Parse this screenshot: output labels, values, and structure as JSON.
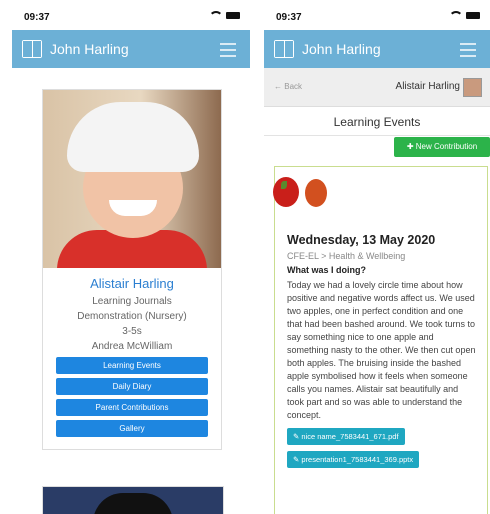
{
  "left": {
    "status_time": "09:37",
    "navbar_title": "John Harling",
    "child_name": "Alistair Harling",
    "journal": "Learning Journals",
    "setting": "Demonstration (Nursery)",
    "age": "3-5s",
    "keyworker": "Andrea McWilliam",
    "buttons": [
      "Learning Events",
      "Daily Diary",
      "Parent Contributions",
      "Gallery"
    ]
  },
  "right": {
    "status_time": "09:37",
    "navbar_title": "John Harling",
    "back_label": "Back",
    "user_name": "Alistair Harling",
    "section_title": "Learning Events",
    "new_button": "New Contribution",
    "entry": {
      "date": "Wednesday, 13 May 2020",
      "category": "CFE-EL > Health & Wellbeing",
      "question": "What was I doing?",
      "body": "Today we had a lovely circle time about how positive and negative words affect us. We used two apples, one in perfect condition and one that had been bashed around. We took turns to say something nice to one apple and something nasty to the other. We then cut open both apples. The bruising inside the bashed apple symbolised how it feels when someone calls you names. Alistair sat beautifully and took part and so was able to understand the concept.",
      "attachments": [
        "nice name_7583441_671.pdf",
        "presentation1_7583441_369.pptx"
      ]
    }
  }
}
